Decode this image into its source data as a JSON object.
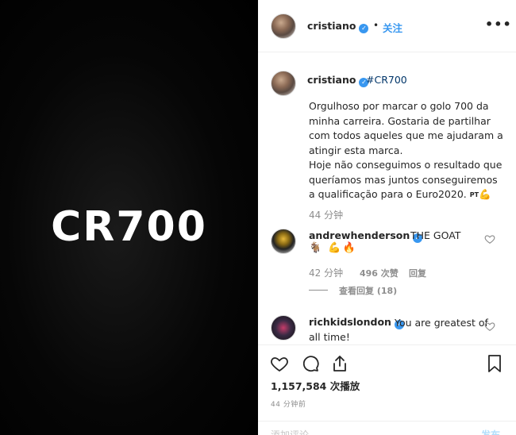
{
  "media": {
    "text": "CR700"
  },
  "header": {
    "username": "cristiano",
    "separator": "•",
    "follow_label": "关注",
    "more_label": "•••"
  },
  "caption": {
    "username": "cristiano",
    "hashtag": "#CR700",
    "lines": [
      "Orgulhoso por marcar o golo 700 da minha carreira. Gostaria de partilhar com todos aqueles que me ajudaram a atingir esta marca.",
      "Hoje não conseguimos o resultado que queríamos mas juntos conseguiremos a qualificação para o Euro2020."
    ],
    "flag_label": "PT",
    "time": "44 分钟"
  },
  "comments": [
    {
      "username": "andrewhenderson",
      "text": "THE GOAT",
      "emoji": "🐐 💪🔥",
      "time": "42 分钟",
      "likes": "496 次赞",
      "reply_label": "回复",
      "view_replies": "查看回复 (18)"
    },
    {
      "username": "richkidslondon",
      "text": "You are greatest of all time!"
    }
  ],
  "footer": {
    "views": "1,157,584 次播放",
    "ago": "44 分钟前",
    "add_comment_placeholder": "添加评论...",
    "post_label": "发布"
  },
  "colors": {
    "link_blue": "#3897f0",
    "hashtag_blue": "#003569",
    "meta_gray": "#8e8e8e",
    "media_bg": "#000000"
  }
}
